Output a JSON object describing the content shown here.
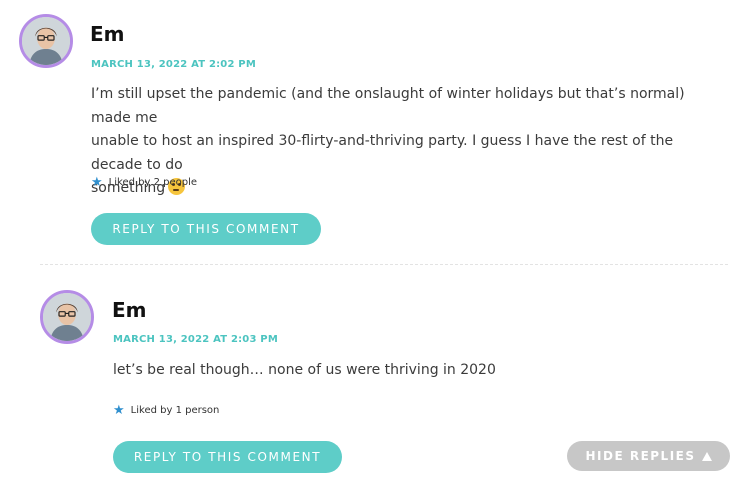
{
  "comments": [
    {
      "author": "Em",
      "date": "MARCH 13, 2022 AT 2:02 PM",
      "lines": [
        "I’m still upset the pandemic (and the onslaught of winter holidays but that’s normal) made me",
        "unable to host an inspired 30-flirty-and-thriving party. I guess I have the rest of the decade to do",
        "something"
      ],
      "emoji": "thinking-face-emoji",
      "likes": "Liked by 2 people",
      "reply_label": "REPLY TO THIS COMMENT"
    },
    {
      "author": "Em",
      "date": "MARCH 13, 2022 AT 2:03 PM",
      "lines": [
        "let’s be real though… none of us were thriving in 2020"
      ],
      "likes": "Liked by 1 person",
      "reply_label": "REPLY TO THIS COMMENT"
    }
  ],
  "hide_replies_label": "HIDE REPLIES",
  "colors": {
    "accent": "#4cc4c0",
    "button": "#5ecdc8",
    "avatar_ring": "#b58ce6",
    "hide_button": "#c7c7c7",
    "star": "#2f8fce"
  },
  "icons": {
    "avatar": "user-avatar-photo",
    "like": "star-icon",
    "hide": "triangle-up-icon"
  }
}
